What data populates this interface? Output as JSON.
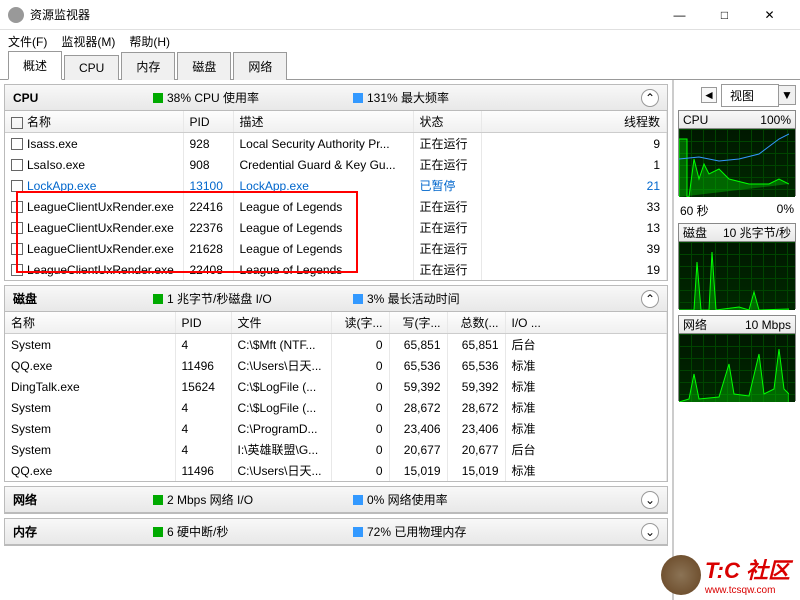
{
  "window": {
    "title": "资源监视器"
  },
  "winbtns": {
    "min": "—",
    "max": "□",
    "close": "✕"
  },
  "menu": {
    "file": "文件(F)",
    "monitor": "监视器(M)",
    "help": "帮助(H)"
  },
  "tabs": [
    {
      "label": "概述",
      "active": true
    },
    {
      "label": "CPU"
    },
    {
      "label": "内存"
    },
    {
      "label": "磁盘"
    },
    {
      "label": "网络"
    }
  ],
  "cpu_section": {
    "title": "CPU",
    "stat1": "38% CPU 使用率",
    "stat2": "131% 最大频率",
    "cols": {
      "name": "名称",
      "pid": "PID",
      "desc": "描述",
      "status": "状态",
      "threads": "线程数"
    },
    "rows": [
      {
        "name": "Isass.exe",
        "pid": "928",
        "desc": "Local Security Authority Pr...",
        "status": "正在运行",
        "threads": "9"
      },
      {
        "name": "LsaIso.exe",
        "pid": "908",
        "desc": "Credential Guard & Key Gu...",
        "status": "正在运行",
        "threads": "1"
      },
      {
        "name": "LockApp.exe",
        "pid": "13100",
        "desc": "LockApp.exe",
        "status": "已暂停",
        "threads": "21",
        "blue": true
      },
      {
        "name": "LeagueClientUxRender.exe",
        "pid": "22416",
        "desc": "League of Legends",
        "status": "正在运行",
        "threads": "33"
      },
      {
        "name": "LeagueClientUxRender.exe",
        "pid": "22376",
        "desc": "League of Legends",
        "status": "正在运行",
        "threads": "13"
      },
      {
        "name": "LeagueClientUxRender.exe",
        "pid": "21628",
        "desc": "League of Legends",
        "status": "正在运行",
        "threads": "39"
      },
      {
        "name": "LeagueClientUxRender.exe",
        "pid": "22408",
        "desc": "League of Legends",
        "status": "正在运行",
        "threads": "19"
      }
    ]
  },
  "disk_section": {
    "title": "磁盘",
    "stat1": "1 兆字节/秒磁盘 I/O",
    "stat2": "3% 最长活动时间",
    "cols": {
      "name": "名称",
      "pid": "PID",
      "file": "文件",
      "read": "读(字...",
      "write": "写(字...",
      "total": "总数(...",
      "io": "I/O ..."
    },
    "rows": [
      {
        "name": "System",
        "pid": "4",
        "file": "C:\\$Mft (NTF...",
        "read": "0",
        "write": "65,851",
        "total": "65,851",
        "io": "后台"
      },
      {
        "name": "QQ.exe",
        "pid": "11496",
        "file": "C:\\Users\\日天...",
        "read": "0",
        "write": "65,536",
        "total": "65,536",
        "io": "标准"
      },
      {
        "name": "DingTalk.exe",
        "pid": "15624",
        "file": "C:\\$LogFile (...",
        "read": "0",
        "write": "59,392",
        "total": "59,392",
        "io": "标准"
      },
      {
        "name": "System",
        "pid": "4",
        "file": "C:\\$LogFile (...",
        "read": "0",
        "write": "28,672",
        "total": "28,672",
        "io": "标准"
      },
      {
        "name": "System",
        "pid": "4",
        "file": "C:\\ProgramD...",
        "read": "0",
        "write": "23,406",
        "total": "23,406",
        "io": "标准"
      },
      {
        "name": "System",
        "pid": "4",
        "file": "I:\\英雄联盟\\G...",
        "read": "0",
        "write": "20,677",
        "total": "20,677",
        "io": "后台"
      },
      {
        "name": "QQ.exe",
        "pid": "11496",
        "file": "C:\\Users\\日天...",
        "read": "0",
        "write": "15,019",
        "total": "15,019",
        "io": "标准"
      }
    ]
  },
  "net_section": {
    "title": "网络",
    "stat1": "2 Mbps 网络 I/O",
    "stat2": "0% 网络使用率"
  },
  "mem_section": {
    "title": "内存",
    "stat1": "6 硬中断/秒",
    "stat2": "72% 已用物理内存"
  },
  "graphs": {
    "view": "视图",
    "cpu": {
      "title": "CPU",
      "value": "100%",
      "footer_l": "60 秒",
      "footer_r": "0%"
    },
    "disk": {
      "title": "磁盘",
      "value": "10 兆字节/秒"
    },
    "net": {
      "title": "网络",
      "value": "10 Mbps"
    }
  },
  "watermark": {
    "text": "T:C 社区",
    "url": "www.tcsqw.com"
  }
}
